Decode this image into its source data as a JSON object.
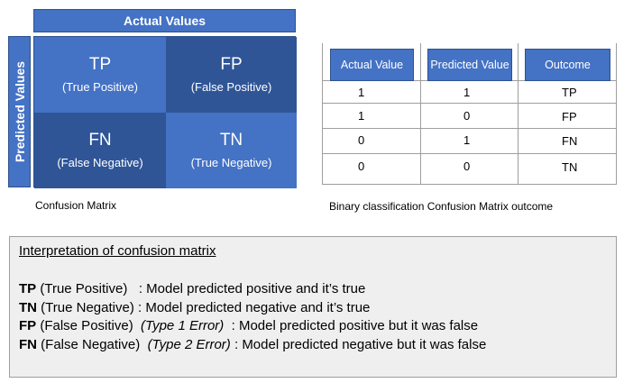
{
  "confusion_matrix": {
    "actual_header": "Actual Values",
    "predicted_header": "Predicted Values",
    "cells": [
      {
        "abbr": "TP",
        "label": "(True Positive)"
      },
      {
        "abbr": "FP",
        "label": "(False Positive)"
      },
      {
        "abbr": "FN",
        "label": "(False Negative)"
      },
      {
        "abbr": "TN",
        "label": "(True Negative)"
      }
    ],
    "caption": "Confusion Matrix"
  },
  "outcome_table": {
    "headers": [
      "Actual Value",
      "Predicted Value",
      "Outcome"
    ],
    "rows": [
      {
        "actual": "1",
        "predicted": "1",
        "outcome": "TP"
      },
      {
        "actual": "1",
        "predicted": "0",
        "outcome": "FP"
      },
      {
        "actual": "0",
        "predicted": "1",
        "outcome": "FN"
      },
      {
        "actual": "0",
        "predicted": "0",
        "outcome": "TN"
      }
    ],
    "caption": "Binary classification Confusion Matrix outcome"
  },
  "interpretation": {
    "title": "Interpretation of confusion matrix",
    "lines": [
      {
        "abbr": "TP",
        "name": "(True Positive)",
        "error": "",
        "text": "Model predicted positive and it’s true"
      },
      {
        "abbr": "TN",
        "name": "(True Negative)",
        "error": "",
        "text": "Model predicted negative and it’s true"
      },
      {
        "abbr": "FP",
        "name": "(False Positive)",
        "error": "(Type 1 Error)",
        "text": "Model predicted positive but it was false"
      },
      {
        "abbr": "FN",
        "name": "(False Negative)",
        "error": "(Type 2 Error)",
        "text": "Model predicted negative but it was  false"
      }
    ]
  }
}
